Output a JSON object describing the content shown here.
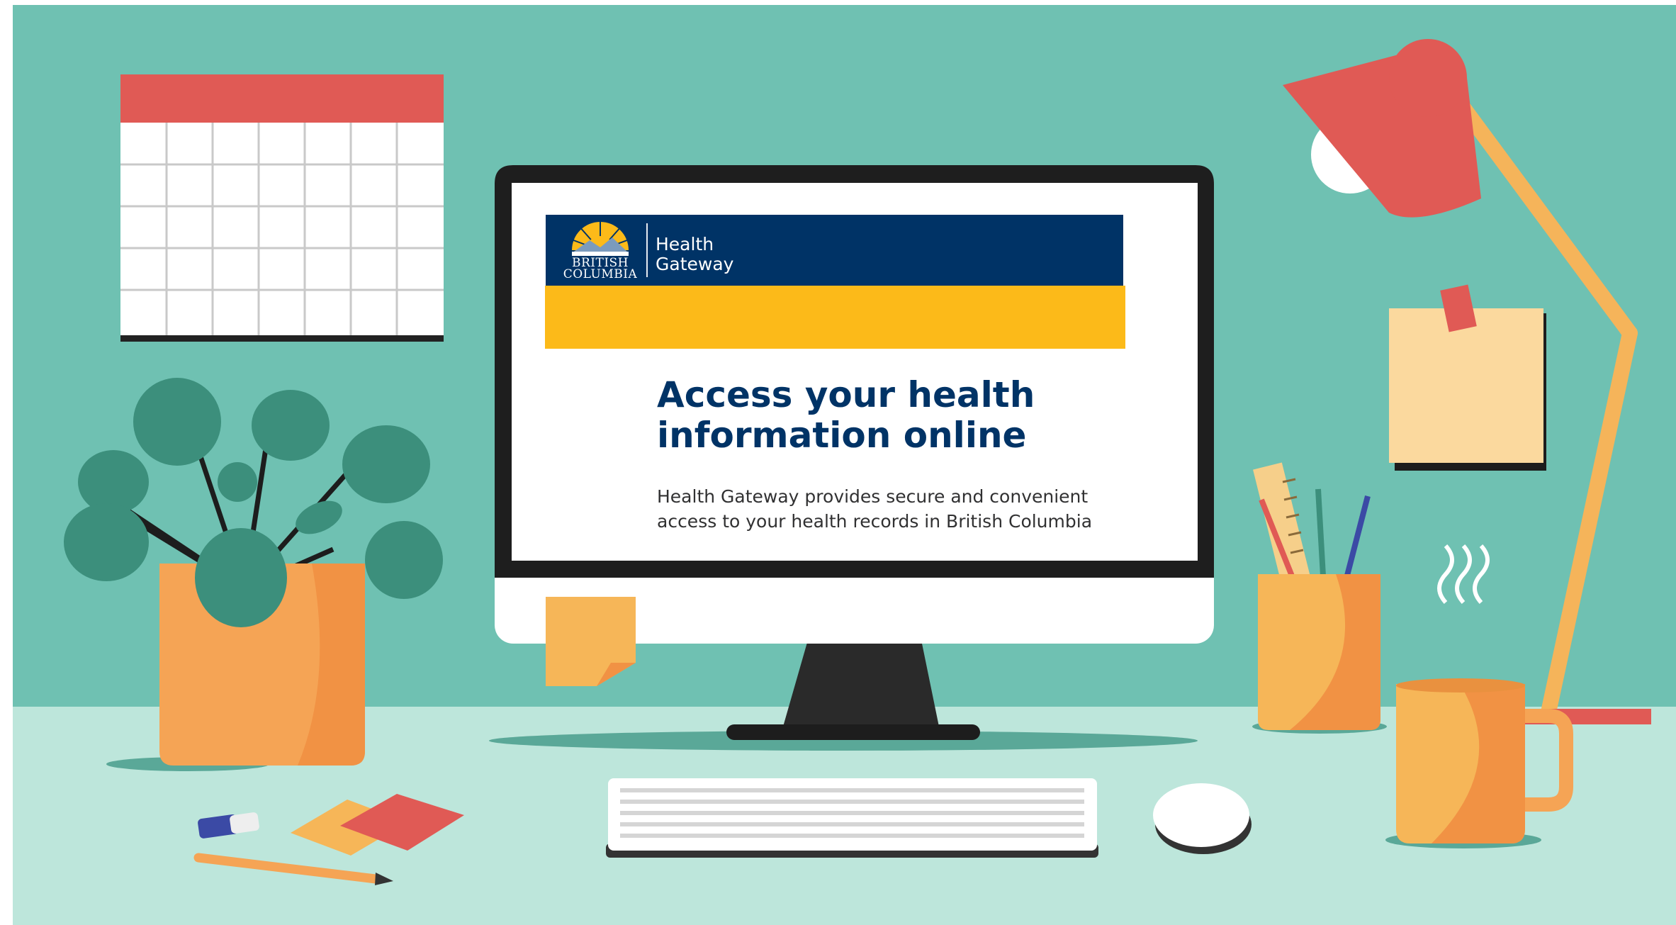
{
  "screen": {
    "brand": {
      "line1": "Health",
      "line2": "Gateway"
    },
    "logo": {
      "name": "bc-government-logo",
      "caption_line1": "BRITISH",
      "caption_line2": "COLUMBIA"
    },
    "hero": {
      "title": "Access your health information online",
      "description": "Health Gateway provides secure and convenient access to your health records in British Columbia"
    }
  },
  "colors": {
    "wall": "#6fc1b2",
    "desk": "#bde6db",
    "bc_blue": "#003366",
    "bc_gold": "#fcba19",
    "coral": "#e05a55",
    "orange": "#f5a455"
  }
}
